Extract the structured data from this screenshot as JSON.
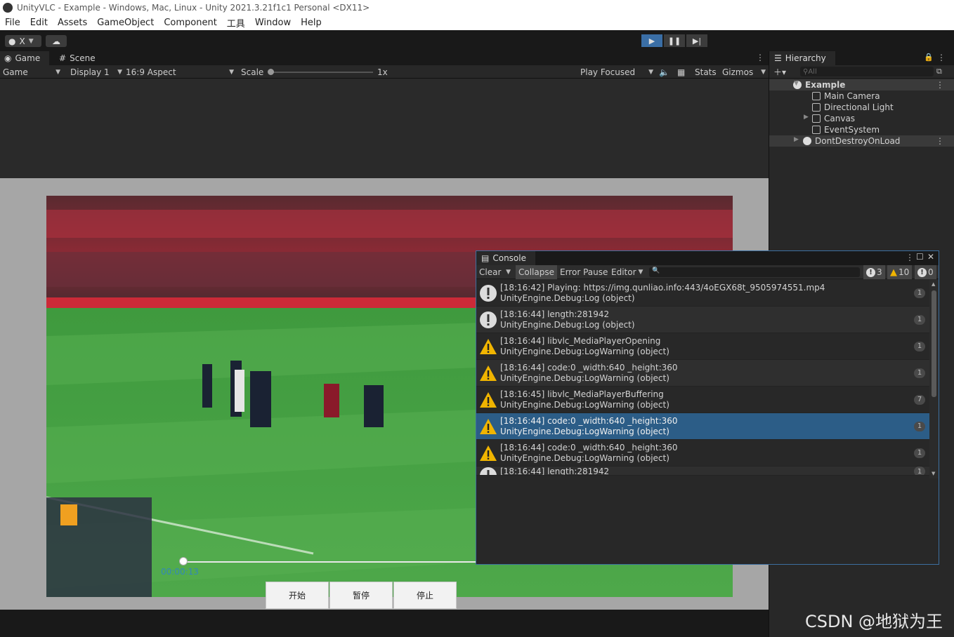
{
  "window": {
    "title": "UnityVLC - Example - Windows, Mac, Linux - Unity 2021.3.21f1c1 Personal <DX11>"
  },
  "menu": [
    "File",
    "Edit",
    "Assets",
    "GameObject",
    "Component",
    "工具",
    "Window",
    "Help"
  ],
  "toolbar": {
    "account_label": "X"
  },
  "tabs": {
    "game": "Game",
    "scene": "Scene"
  },
  "game_bar": {
    "mode": "Game",
    "display": "Display 1",
    "aspect": "16:9 Aspect",
    "scale_label": "Scale",
    "scale_value": "1x",
    "play_focused": "Play Focused",
    "stats": "Stats",
    "gizmos": "Gizmos"
  },
  "player": {
    "time": "00:00:13",
    "buttons": [
      "开始",
      "暂停",
      "停止"
    ],
    "progress": 0.0
  },
  "hierarchy": {
    "title": "Hierarchy",
    "search_placeholder": "All",
    "items": [
      {
        "label": "Example",
        "depth": 0,
        "type": "scene",
        "expanded": true
      },
      {
        "label": "Main Camera",
        "depth": 1,
        "type": "object"
      },
      {
        "label": "Directional Light",
        "depth": 1,
        "type": "object"
      },
      {
        "label": "Canvas",
        "depth": 1,
        "type": "object",
        "collapsed_arrow": true
      },
      {
        "label": "EventSystem",
        "depth": 1,
        "type": "object"
      },
      {
        "label": "DontDestroyOnLoad",
        "depth": 0,
        "type": "scene",
        "expanded": false
      }
    ]
  },
  "console": {
    "title": "Console",
    "buttons": {
      "clear": "Clear",
      "collapse": "Collapse",
      "error_pause": "Error Pause",
      "editor": "Editor"
    },
    "counts": {
      "log": "3",
      "warning": "10",
      "error": "0"
    },
    "entries": [
      {
        "type": "log",
        "line1": "[18:16:42] Playing: https://img.qunliao.info:443/4oEGX68t_9505974551.mp4",
        "line2": "UnityEngine.Debug:Log (object)",
        "count": "1"
      },
      {
        "type": "log",
        "line1": "[18:16:44] length:281942",
        "line2": "UnityEngine.Debug:Log (object)",
        "count": "1"
      },
      {
        "type": "warning",
        "line1": "[18:16:44] libvlc_MediaPlayerOpening",
        "line2": "UnityEngine.Debug:LogWarning (object)",
        "count": "1"
      },
      {
        "type": "warning",
        "line1": "[18:16:44] code:0 _width:640 _height:360",
        "line2": "UnityEngine.Debug:LogWarning (object)",
        "count": "1"
      },
      {
        "type": "warning",
        "line1": "[18:16:45] libvlc_MediaPlayerBuffering",
        "line2": "UnityEngine.Debug:LogWarning (object)",
        "count": "7"
      },
      {
        "type": "warning",
        "line1": "[18:16:44] code:0 _width:640 _height:360",
        "line2": "UnityEngine.Debug:LogWarning (object)",
        "count": "1",
        "selected": true
      },
      {
        "type": "warning",
        "line1": "[18:16:44] code:0 _width:640 _height:360",
        "line2": "UnityEngine.Debug:LogWarning (object)",
        "count": "1"
      },
      {
        "type": "log",
        "line1": "[18:16:44] length:281942",
        "line2": "",
        "count": "1"
      }
    ]
  },
  "watermark": "CSDN @地狱为王",
  "colors": {
    "accent": "#2c5d87",
    "play_active": "#3a6ea5",
    "warning": "#f0b400"
  }
}
